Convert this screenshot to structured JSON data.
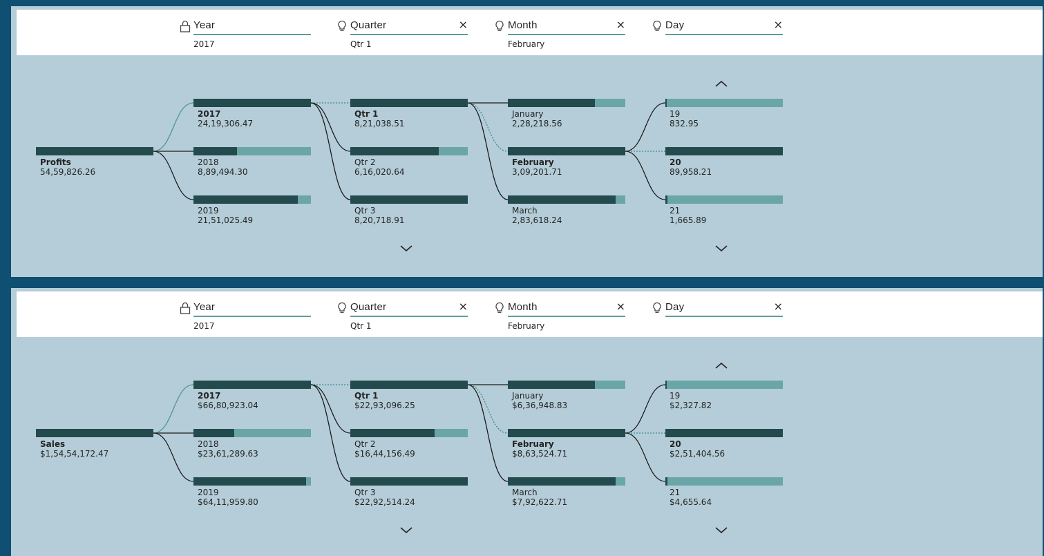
{
  "header": {
    "levels": [
      {
        "title": "Year",
        "value": "2017",
        "icon": "lock-icon",
        "closable": false
      },
      {
        "title": "Quarter",
        "value": "Qtr 1",
        "icon": "lightbulb-icon",
        "closable": true
      },
      {
        "title": "Month",
        "value": "February",
        "icon": "lightbulb-icon",
        "closable": true
      },
      {
        "title": "Day",
        "value": "",
        "icon": "lightbulb-icon",
        "closable": true
      }
    ],
    "close_glyph": "×"
  },
  "colors": {
    "panel_bg": "#b4cdd8",
    "page_bg": "#0f4f72",
    "bar_dark": "#234a4c",
    "bar_light": "#6aa6a6",
    "accent_line": "#5e9e9c"
  },
  "chart_data": [
    {
      "type": "decomposition-tree",
      "root": {
        "label": "Profits",
        "value": "54,59,826.26",
        "amount": 5459826.26
      },
      "levels": [
        {
          "name": "Year",
          "items": [
            {
              "label": "2017",
              "value": "24,19,306.47",
              "amount": 2419306.47,
              "fill": 1.0,
              "selected": true
            },
            {
              "label": "2018",
              "value": "8,89,494.30",
              "amount": 889494.3,
              "fill": 0.37,
              "selected": false
            },
            {
              "label": "2019",
              "value": "21,51,025.49",
              "amount": 2151025.49,
              "fill": 0.89,
              "selected": false
            }
          ]
        },
        {
          "name": "Quarter",
          "items": [
            {
              "label": "Qtr 1",
              "value": "8,21,038.51",
              "amount": 821038.51,
              "fill": 1.0,
              "selected": true
            },
            {
              "label": "Qtr 2",
              "value": "6,16,020.64",
              "amount": 616020.64,
              "fill": 0.75,
              "selected": false
            },
            {
              "label": "Qtr 3",
              "value": "8,20,718.91",
              "amount": 820718.91,
              "fill": 1.0,
              "selected": false
            }
          ]
        },
        {
          "name": "Month",
          "items": [
            {
              "label": "January",
              "value": "2,28,218.56",
              "amount": 228218.56,
              "fill": 0.74,
              "selected": false
            },
            {
              "label": "February",
              "value": "3,09,201.71",
              "amount": 309201.71,
              "fill": 1.0,
              "selected": true
            },
            {
              "label": "March",
              "value": "2,83,618.24",
              "amount": 283618.24,
              "fill": 0.92,
              "selected": false
            }
          ]
        },
        {
          "name": "Day",
          "items": [
            {
              "label": "19",
              "value": "832.95",
              "amount": 832.95,
              "fill": 0.01,
              "selected": false
            },
            {
              "label": "20",
              "value": "89,958.21",
              "amount": 89958.21,
              "fill": 1.0,
              "selected": true
            },
            {
              "label": "21",
              "value": "1,665.89",
              "amount": 1665.89,
              "fill": 0.02,
              "selected": false
            }
          ]
        }
      ],
      "scroll_up": [
        false,
        false,
        false,
        true
      ],
      "scroll_down": [
        false,
        true,
        false,
        true
      ]
    },
    {
      "type": "decomposition-tree",
      "root": {
        "label": "Sales",
        "value": "$1,54,54,172.47",
        "amount": 15454172.47
      },
      "levels": [
        {
          "name": "Year",
          "items": [
            {
              "label": "2017",
              "value": "$66,80,923.04",
              "amount": 6680923.04,
              "fill": 1.0,
              "selected": true
            },
            {
              "label": "2018",
              "value": "$23,61,289.63",
              "amount": 2361289.63,
              "fill": 0.35,
              "selected": false
            },
            {
              "label": "2019",
              "value": "$64,11,959.80",
              "amount": 6411959.8,
              "fill": 0.96,
              "selected": false
            }
          ]
        },
        {
          "name": "Quarter",
          "items": [
            {
              "label": "Qtr 1",
              "value": "$22,93,096.25",
              "amount": 2293096.25,
              "fill": 1.0,
              "selected": true
            },
            {
              "label": "Qtr 2",
              "value": "$16,44,156.49",
              "amount": 1644156.49,
              "fill": 0.72,
              "selected": false
            },
            {
              "label": "Qtr 3",
              "value": "$22,92,514.24",
              "amount": 2292514.24,
              "fill": 1.0,
              "selected": false
            }
          ]
        },
        {
          "name": "Month",
          "items": [
            {
              "label": "January",
              "value": "$6,36,948.83",
              "amount": 636948.83,
              "fill": 0.74,
              "selected": false
            },
            {
              "label": "February",
              "value": "$8,63,524.71",
              "amount": 863524.71,
              "fill": 1.0,
              "selected": true
            },
            {
              "label": "March",
              "value": "$7,92,622.71",
              "amount": 792622.71,
              "fill": 0.92,
              "selected": false
            }
          ]
        },
        {
          "name": "Day",
          "items": [
            {
              "label": "19",
              "value": "$2,327.82",
              "amount": 2327.82,
              "fill": 0.01,
              "selected": false
            },
            {
              "label": "20",
              "value": "$2,51,404.56",
              "amount": 251404.56,
              "fill": 1.0,
              "selected": true
            },
            {
              "label": "21",
              "value": "$4,655.64",
              "amount": 4655.64,
              "fill": 0.02,
              "selected": false
            }
          ]
        }
      ],
      "scroll_up": [
        false,
        false,
        false,
        true
      ],
      "scroll_down": [
        false,
        true,
        false,
        true
      ]
    }
  ]
}
